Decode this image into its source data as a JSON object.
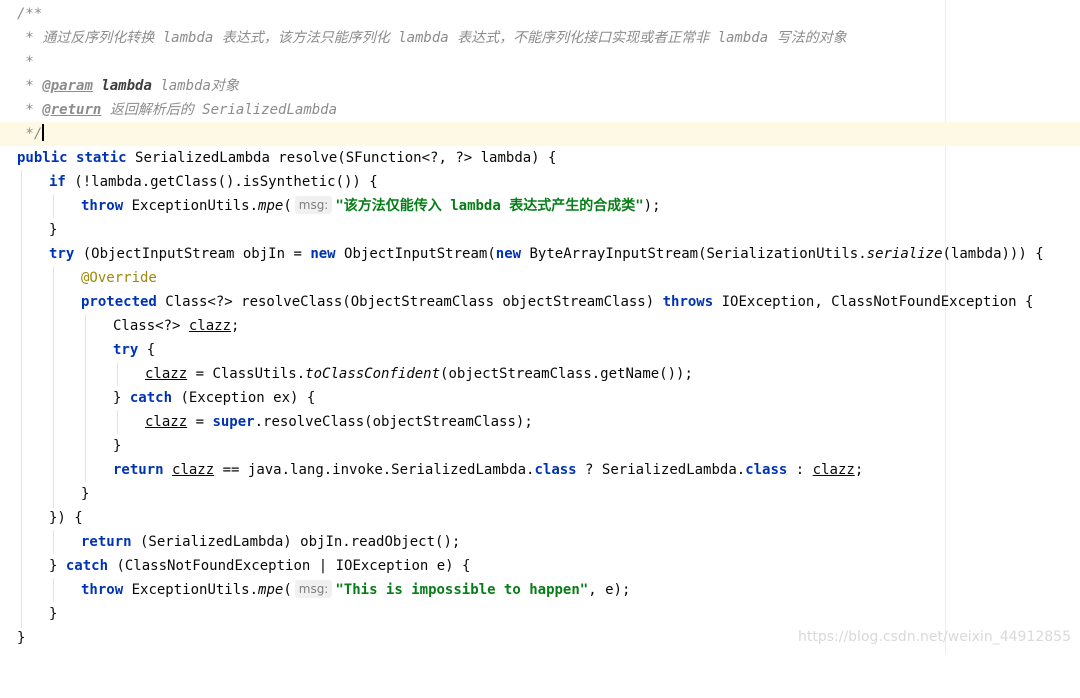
{
  "editor": {
    "comment": {
      "open": "/**",
      "star": " *",
      "desc": " * 通过反序列化转换 lambda 表达式，该方法只能序列化 lambda 表达式，不能序列化接口实现或者正常非 lambda 写法的对象",
      "param_tag": "@param",
      "param_name": "lambda",
      "param_desc": "lambda对象",
      "return_tag": "@return",
      "return_desc": "返回解析后的 SerializedLambda",
      "close": " */"
    },
    "tokens": {
      "public": "public",
      "static": "static",
      "if": "if",
      "throw": "throw",
      "try": "try",
      "new": "new",
      "protected": "protected",
      "throws": "throws",
      "catch": "catch",
      "super": "super",
      "return": "return",
      "class": "class",
      "override": "@Override",
      "msg": "msg:"
    },
    "code": {
      "l7a": " SerializedLambda resolve(SFunction<?, ?> lambda) {",
      "l8a": " (!lambda.getClass().isSynthetic()) {",
      "l9a": " ExceptionUtils.",
      "l9b": "mpe",
      "l9c": "(",
      "l9str": "\"该方法仅能传入 lambda 表达式产生的合成类\"",
      "l9d": ");",
      "l10": "}",
      "l11a": " (ObjectInputStream objIn = ",
      "l11b": " ObjectInputStream(",
      "l11c": " ByteArrayInputStream(SerializationUtils.",
      "l11d": "serialize",
      "l11e": "(lambda))) {",
      "l13a": " Class<?> resolveClass(ObjectStreamClass objectStreamClass) ",
      "l13b": " IOException, ClassNotFoundException {",
      "l14a": "Class<?> ",
      "l14b": "clazz",
      "l14c": ";",
      "l15a": " {",
      "l16a": "clazz",
      "l16b": " = ClassUtils.",
      "l16c": "toClassConfident",
      "l16d": "(objectStreamClass.getName());",
      "l17a": "} ",
      "l17b": " (Exception ex) {",
      "l18a": "clazz",
      "l18b": " = ",
      "l18c": ".resolveClass(objectStreamClass);",
      "l19": "}",
      "l20a": " ",
      "l20b": "clazz",
      "l20c": " == java.lang.invoke.SerializedLambda.",
      "l20d": " ? SerializedLambda.",
      "l20e": " : ",
      "l20f": "clazz",
      "l20g": ";",
      "l21": "}",
      "l22": "}) {",
      "l23a": " (SerializedLambda) objIn.readObject();",
      "l24a": "} ",
      "l24b": " (ClassNotFoundException | IOException e) {",
      "l25a": " ExceptionUtils.",
      "l25b": "mpe",
      "l25c": "(",
      "l25str": "\"This is impossible to happen\"",
      "l25d": ", e);",
      "l26": "}",
      "l27": "}"
    }
  },
  "watermark": "https://blog.csdn.net/weixin_44912855"
}
